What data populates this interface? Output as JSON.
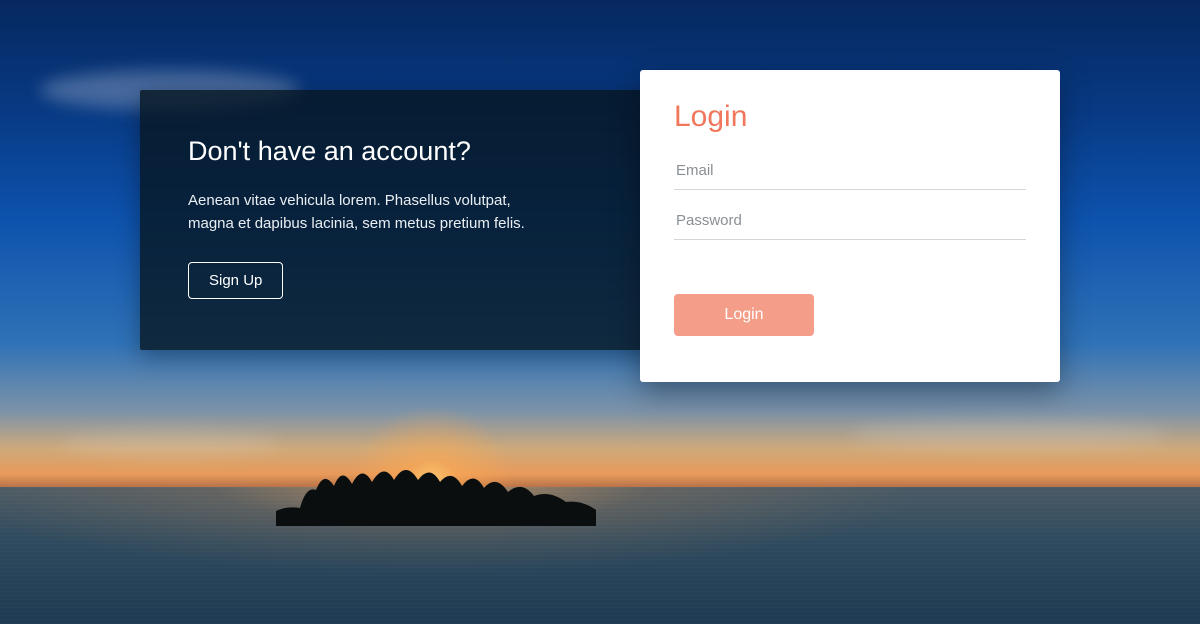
{
  "promo": {
    "heading": "Don't have an account?",
    "body": "Aenean vitae vehicula lorem. Phasellus volutpat, magna et dapibus lacinia, sem metus pretium felis.",
    "signup_label": "Sign Up"
  },
  "login": {
    "title": "Login",
    "email_placeholder": "Email",
    "password_placeholder": "Password",
    "email_value": "",
    "password_value": "",
    "submit_label": "Login"
  },
  "colors": {
    "accent": "#f0775b",
    "accent_soft": "#f49d88"
  }
}
